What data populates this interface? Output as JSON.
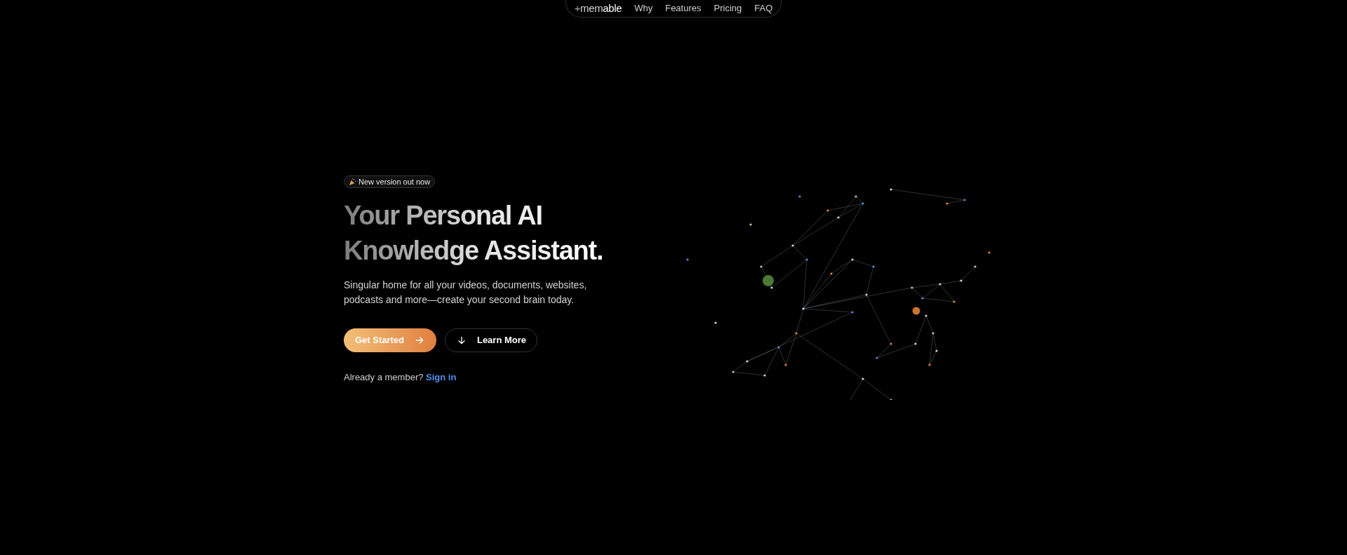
{
  "nav": {
    "logo": {
      "prefix": "+",
      "light": "mem",
      "bold": "able"
    },
    "links": [
      {
        "label": "Why"
      },
      {
        "label": "Features"
      },
      {
        "label": "Pricing"
      },
      {
        "label": "FAQ"
      }
    ]
  },
  "hero": {
    "badge": "New version out now",
    "title_lines": [
      "Your Personal AI",
      "Knowledge Assistant."
    ],
    "subtitle": "Singular home for all your videos, documents, websites, podcasts and more—create your second brain today.",
    "buttons": [
      {
        "label": "Get Started",
        "kind": "primary"
      },
      {
        "label": "Learn More",
        "kind": "secondary"
      }
    ],
    "member_prompt": "Already a member?",
    "sign_in": "Sign in"
  }
}
